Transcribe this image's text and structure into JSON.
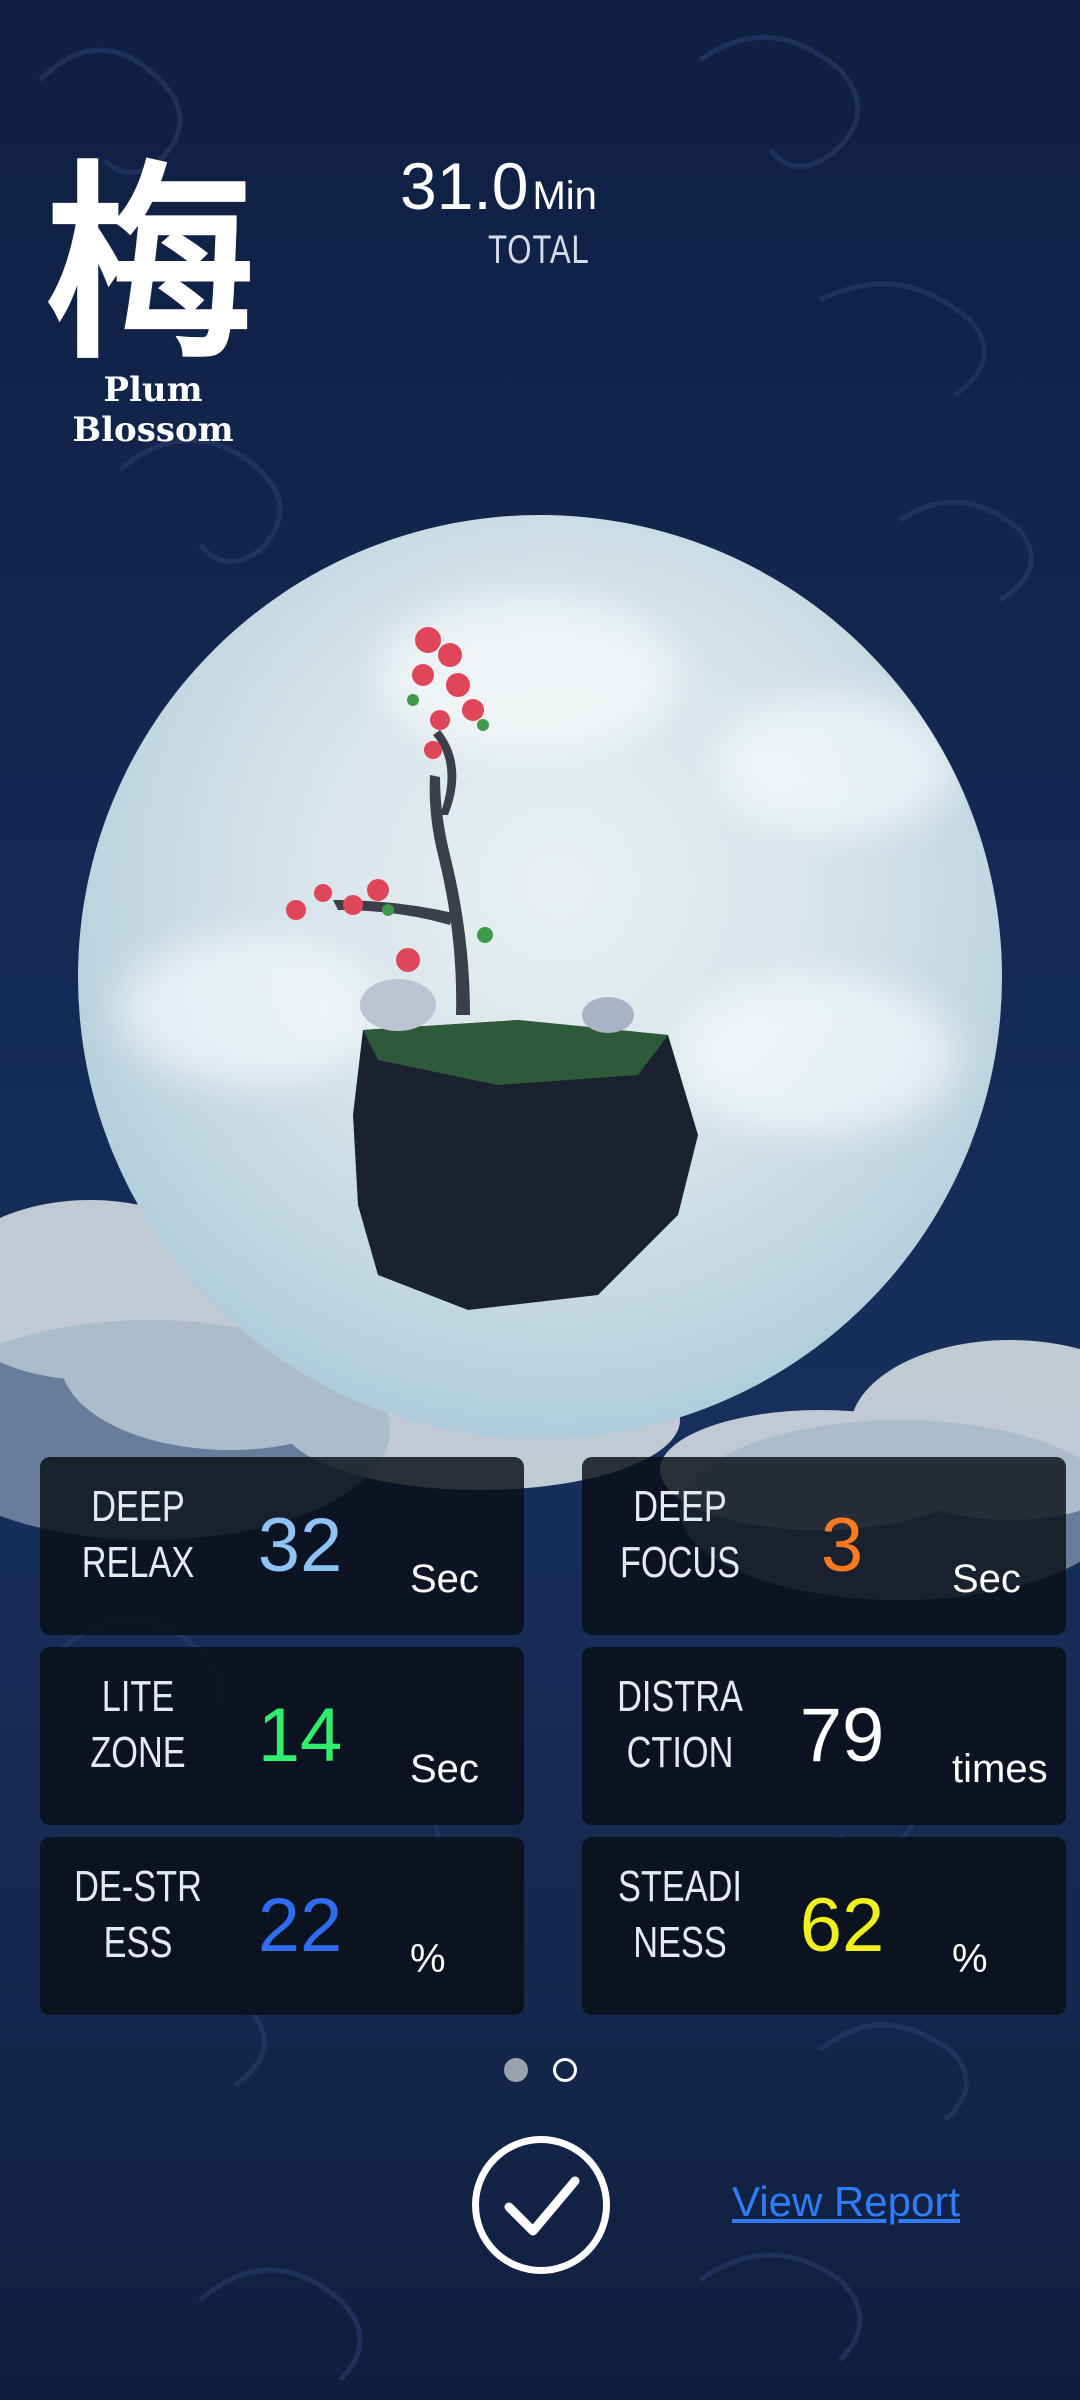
{
  "logo": {
    "glyph": "梅",
    "name": "Plum Blossom"
  },
  "total": {
    "value": "31.0",
    "unit": "Min",
    "label": "TOTAL"
  },
  "stats": [
    {
      "label": "DEEP\nRELAX",
      "value": "32",
      "unit": "Sec",
      "color": "#8fc2f5"
    },
    {
      "label": "DEEP\nFOCUS",
      "value": "3",
      "unit": "Sec",
      "color": "#ff7a1f"
    },
    {
      "label": "LITE\nZONE",
      "value": "14",
      "unit": "Sec",
      "color": "#2ef06e"
    },
    {
      "label": "DISTRA\nCTION",
      "value": "79",
      "unit": "times",
      "color": "#ffffff"
    },
    {
      "label": "DE-STR\nESS",
      "value": "22",
      "unit": "%",
      "color": "#2f6cf0"
    },
    {
      "label": "STEADI\nNESS",
      "value": "62",
      "unit": "%",
      "color": "#f0f01c"
    }
  ],
  "pager": {
    "pages": 2,
    "current": 1
  },
  "actions": {
    "view_report": "View Report",
    "done_icon": "checkmark-circle-icon"
  }
}
